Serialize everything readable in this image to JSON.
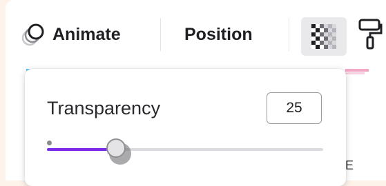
{
  "toolbar": {
    "animate_label": "Animate",
    "animate_icon": "animate-circles-icon",
    "position_label": "Position",
    "transparency_icon": "checkerboard-icon",
    "paint_icon": "paint-roller-icon"
  },
  "transparency_popover": {
    "label": "Transparency",
    "value": "25",
    "slider_percent": 25
  },
  "canvas": {
    "partial_letter": "E"
  },
  "colors": {
    "accent": "#7d2ae8",
    "page_background": "#fdf3ea",
    "toolbar_active": "#e9e9ec"
  }
}
